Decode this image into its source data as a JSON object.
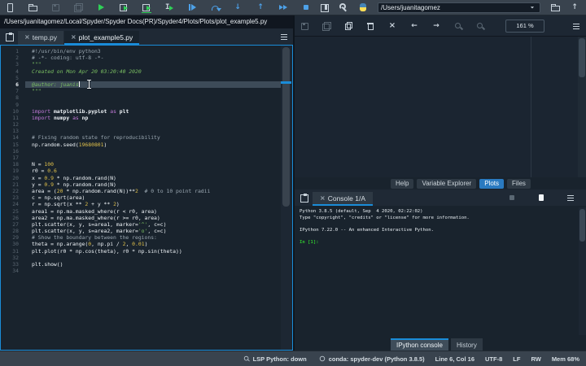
{
  "accent": "#1a8cd8",
  "main_toolbar": {
    "cwd_value": "/Users/juanitagomez",
    "left_icons": [
      {
        "name": "new-file",
        "glyph": "page",
        "color": "light"
      },
      {
        "name": "open-file",
        "glyph": "folder",
        "color": "light"
      },
      {
        "name": "save-file",
        "glyph": "floppy",
        "color": "dim"
      },
      {
        "name": "save-all",
        "glyph": "floppy2",
        "color": "dim"
      },
      {
        "name": "run-file",
        "glyph": "play",
        "color": "green"
      },
      {
        "name": "run-cell",
        "glyph": "cellplay",
        "color": "light"
      },
      {
        "name": "run-cell-advance",
        "glyph": "cellplay2",
        "color": "light"
      },
      {
        "name": "run-selection",
        "glyph": "ibeamplay",
        "color": "light"
      },
      {
        "name": "debug-file",
        "glyph": "dbgplay",
        "color": "blue"
      },
      {
        "name": "step-over",
        "glyph": "curve",
        "color": "blue"
      },
      {
        "name": "step-into",
        "glyph": "down",
        "color": "blue"
      },
      {
        "name": "step-return",
        "glyph": "up",
        "color": "blue"
      },
      {
        "name": "continue-execution",
        "glyph": "dplay",
        "color": "blue"
      },
      {
        "name": "stop-debugging",
        "glyph": "square",
        "color": "blue"
      }
    ],
    "right_icons": [
      {
        "name": "maximize-pane",
        "glyph": "maxpane",
        "color": "light"
      },
      {
        "name": "preferences",
        "glyph": "wrench",
        "color": "light"
      },
      {
        "name": "pythonpath-manager",
        "glyph": "python",
        "color": "light"
      }
    ],
    "cwd_icons": [
      {
        "name": "browse-working-directory",
        "glyph": "folder",
        "color": "light"
      },
      {
        "name": "parent-directory",
        "glyph": "up",
        "color": "light"
      }
    ]
  },
  "editor": {
    "path": "/Users/juanitagomez/Local/Spyder/Spyder Docs(PR)/Spyder4/Plots/Plots/plot_example5.py",
    "tabs": [
      {
        "label": "temp.py",
        "active": false,
        "closable": true
      },
      {
        "label": "plot_example5.py",
        "active": true,
        "closable": true
      }
    ],
    "cursor_line": 6,
    "lines": [
      {
        "n": 1,
        "seg": [
          [
            "#!/usr/bin/env python3",
            "c"
          ]
        ]
      },
      {
        "n": 2,
        "seg": [
          [
            "# -*- coding: utf-8 -*-",
            "c"
          ]
        ]
      },
      {
        "n": 3,
        "seg": [
          [
            "\"\"\"",
            "d"
          ]
        ]
      },
      {
        "n": 4,
        "seg": [
          [
            "Created on Mon Apr 20 03:20:40 2020",
            "d"
          ]
        ]
      },
      {
        "n": 5,
        "seg": []
      },
      {
        "n": 6,
        "seg": [
          [
            "@author: juanis",
            "d"
          ]
        ]
      },
      {
        "n": 7,
        "seg": [
          [
            "\"\"\"",
            "d"
          ]
        ]
      },
      {
        "n": 8,
        "seg": []
      },
      {
        "n": 9,
        "seg": []
      },
      {
        "n": 10,
        "seg": [
          [
            "import",
            "k"
          ],
          [
            " ",
            ""
          ],
          [
            "matplotlib.pyplot",
            "b"
          ],
          [
            " ",
            ""
          ],
          [
            "as",
            "k"
          ],
          [
            " ",
            ""
          ],
          [
            "plt",
            "b"
          ]
        ]
      },
      {
        "n": 11,
        "seg": [
          [
            "import",
            "k"
          ],
          [
            " ",
            ""
          ],
          [
            "numpy",
            "b"
          ],
          [
            " ",
            ""
          ],
          [
            "as",
            "k"
          ],
          [
            " ",
            ""
          ],
          [
            "np",
            "b"
          ]
        ]
      },
      {
        "n": 12,
        "seg": []
      },
      {
        "n": 13,
        "seg": []
      },
      {
        "n": 14,
        "seg": [
          [
            "# Fixing random state for reproducibility",
            "c"
          ]
        ]
      },
      {
        "n": 15,
        "seg": [
          [
            "np.random.seed(",
            ""
          ],
          [
            "19680801",
            "num"
          ],
          [
            ")",
            ""
          ]
        ]
      },
      {
        "n": 16,
        "seg": []
      },
      {
        "n": 17,
        "seg": []
      },
      {
        "n": 18,
        "seg": [
          [
            "N = ",
            ""
          ],
          [
            "100",
            "num"
          ]
        ]
      },
      {
        "n": 19,
        "seg": [
          [
            "r0 = ",
            ""
          ],
          [
            "0.6",
            "num"
          ]
        ]
      },
      {
        "n": 20,
        "seg": [
          [
            "x = ",
            ""
          ],
          [
            "0.9",
            "num"
          ],
          [
            " * np.random.rand(N)",
            ""
          ]
        ]
      },
      {
        "n": 21,
        "seg": [
          [
            "y = ",
            ""
          ],
          [
            "0.9",
            "num"
          ],
          [
            " * np.random.rand(N)",
            ""
          ]
        ]
      },
      {
        "n": 22,
        "seg": [
          [
            "area = (",
            ""
          ],
          [
            "20",
            "num"
          ],
          [
            " * np.random.rand(N))**",
            ""
          ],
          [
            "2",
            "num"
          ],
          [
            "  ",
            ""
          ],
          [
            "# 0 to 10 point radii",
            "c"
          ]
        ]
      },
      {
        "n": 23,
        "seg": [
          [
            "c = np.sqrt(area)",
            ""
          ]
        ]
      },
      {
        "n": 24,
        "seg": [
          [
            "r = np.sqrt(x ** ",
            ""
          ],
          [
            "2",
            "num"
          ],
          [
            " + y ** ",
            ""
          ],
          [
            "2",
            "num"
          ],
          [
            ")",
            ""
          ]
        ]
      },
      {
        "n": 25,
        "seg": [
          [
            "area1 = np.ma.masked_where(r < r0, area)",
            ""
          ]
        ]
      },
      {
        "n": 26,
        "seg": [
          [
            "area2 = np.ma.masked_where(r >= r0, area)",
            ""
          ]
        ]
      },
      {
        "n": 27,
        "seg": [
          [
            "plt.scatter(x, y, s=area1, marker=",
            ""
          ],
          [
            "'^'",
            "s"
          ],
          [
            ", c=c)",
            ""
          ]
        ]
      },
      {
        "n": 28,
        "seg": [
          [
            "plt.scatter(x, y, s=area2, marker=",
            ""
          ],
          [
            "'o'",
            "s"
          ],
          [
            ", c=c)",
            ""
          ]
        ]
      },
      {
        "n": 29,
        "seg": [
          [
            "# Show the boundary between the regions:",
            "c"
          ]
        ]
      },
      {
        "n": 30,
        "seg": [
          [
            "theta = np.arange(",
            ""
          ],
          [
            "0",
            "num"
          ],
          [
            ", np.pi / ",
            ""
          ],
          [
            "2",
            "num"
          ],
          [
            ", ",
            ""
          ],
          [
            "0.01",
            "num"
          ],
          [
            ")",
            ""
          ]
        ]
      },
      {
        "n": 31,
        "seg": [
          [
            "plt.plot(r0 * np.cos(theta), r0 * np.sin(theta))",
            ""
          ]
        ]
      },
      {
        "n": 32,
        "seg": []
      },
      {
        "n": 33,
        "seg": [
          [
            "plt.show()",
            ""
          ]
        ]
      },
      {
        "n": 34,
        "seg": []
      }
    ]
  },
  "plots_toolbar": {
    "zoom_level": "161 %",
    "icons": [
      {
        "name": "save-plot",
        "glyph": "floppy",
        "color": "dim"
      },
      {
        "name": "save-all-plots",
        "glyph": "floppy2",
        "color": "dim"
      },
      {
        "name": "copy-plot",
        "glyph": "copy",
        "color": "light"
      },
      {
        "name": "remove-plot",
        "glyph": "trash",
        "color": "light"
      },
      {
        "name": "remove-all-plots",
        "glyph": "x",
        "color": "light"
      },
      {
        "name": "previous-plot",
        "glyph": "left",
        "color": "light"
      },
      {
        "name": "next-plot",
        "glyph": "right",
        "color": "light"
      },
      {
        "name": "zoom-in",
        "glyph": "zoom",
        "color": "dim"
      },
      {
        "name": "zoom-out",
        "glyph": "zoom",
        "color": "dim"
      }
    ]
  },
  "pane_tabs": [
    {
      "label": "Help",
      "active": false
    },
    {
      "label": "Variable Explorer",
      "active": false
    },
    {
      "label": "Plots",
      "active": true
    },
    {
      "label": "Files",
      "active": false
    }
  ],
  "console": {
    "tab_label": "Console 1/A",
    "toolbar_icons": [
      {
        "name": "interrupt-kernel",
        "glyph": "square",
        "color": "dim"
      },
      {
        "name": "clipboard",
        "glyph": "clipboard",
        "color": "white"
      },
      {
        "name": "console-options",
        "glyph": "menu",
        "color": "light"
      }
    ],
    "lines": [
      {
        "t": "Python 3.8.5 (default, Sep  4 2020, 02:22:02) ",
        "cls": ""
      },
      {
        "t": "Type \"copyright\", \"credits\" or \"license\" for more information.",
        "cls": ""
      },
      {
        "t": "",
        "cls": ""
      },
      {
        "t": "IPython 7.22.0 -- An enhanced Interactive Python.",
        "cls": ""
      },
      {
        "t": "",
        "cls": ""
      },
      {
        "t": "In [1]:",
        "cls": "in"
      }
    ],
    "bottom_tabs": [
      {
        "label": "IPython console",
        "active": true
      },
      {
        "label": "History",
        "active": false
      }
    ]
  },
  "status": {
    "items": [
      {
        "icon": "plug",
        "name": "lsp-status",
        "label": "LSP Python: down"
      },
      {
        "icon": "circ",
        "name": "interpreter-status",
        "label": "conda: spyder-dev (Python 3.8.5)"
      },
      {
        "icon": "",
        "name": "cursor-position",
        "label": "Line 6, Col 16"
      },
      {
        "icon": "",
        "name": "encoding",
        "label": "UTF-8"
      },
      {
        "icon": "",
        "name": "eol-status",
        "label": "LF"
      },
      {
        "icon": "",
        "name": "readwrite-status",
        "label": "RW"
      },
      {
        "icon": "",
        "name": "memory-usage",
        "label": "Mem 68%"
      }
    ]
  }
}
